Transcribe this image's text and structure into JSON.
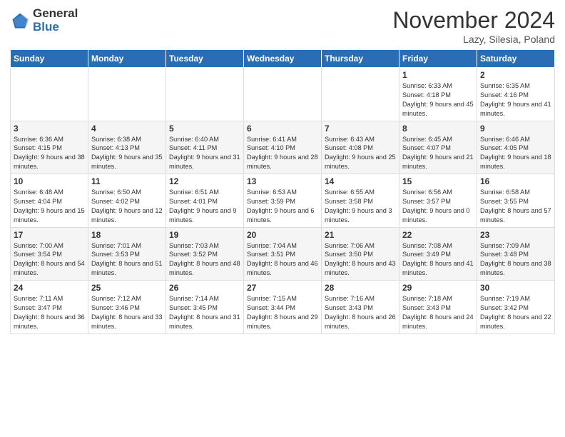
{
  "logo": {
    "general": "General",
    "blue": "Blue"
  },
  "header": {
    "month": "November 2024",
    "location": "Lazy, Silesia, Poland"
  },
  "weekdays": [
    "Sunday",
    "Monday",
    "Tuesday",
    "Wednesday",
    "Thursday",
    "Friday",
    "Saturday"
  ],
  "weeks": [
    [
      {
        "day": "",
        "info": ""
      },
      {
        "day": "",
        "info": ""
      },
      {
        "day": "",
        "info": ""
      },
      {
        "day": "",
        "info": ""
      },
      {
        "day": "",
        "info": ""
      },
      {
        "day": "1",
        "info": "Sunrise: 6:33 AM\nSunset: 4:18 PM\nDaylight: 9 hours and 45 minutes."
      },
      {
        "day": "2",
        "info": "Sunrise: 6:35 AM\nSunset: 4:16 PM\nDaylight: 9 hours and 41 minutes."
      }
    ],
    [
      {
        "day": "3",
        "info": "Sunrise: 6:36 AM\nSunset: 4:15 PM\nDaylight: 9 hours and 38 minutes."
      },
      {
        "day": "4",
        "info": "Sunrise: 6:38 AM\nSunset: 4:13 PM\nDaylight: 9 hours and 35 minutes."
      },
      {
        "day": "5",
        "info": "Sunrise: 6:40 AM\nSunset: 4:11 PM\nDaylight: 9 hours and 31 minutes."
      },
      {
        "day": "6",
        "info": "Sunrise: 6:41 AM\nSunset: 4:10 PM\nDaylight: 9 hours and 28 minutes."
      },
      {
        "day": "7",
        "info": "Sunrise: 6:43 AM\nSunset: 4:08 PM\nDaylight: 9 hours and 25 minutes."
      },
      {
        "day": "8",
        "info": "Sunrise: 6:45 AM\nSunset: 4:07 PM\nDaylight: 9 hours and 21 minutes."
      },
      {
        "day": "9",
        "info": "Sunrise: 6:46 AM\nSunset: 4:05 PM\nDaylight: 9 hours and 18 minutes."
      }
    ],
    [
      {
        "day": "10",
        "info": "Sunrise: 6:48 AM\nSunset: 4:04 PM\nDaylight: 9 hours and 15 minutes."
      },
      {
        "day": "11",
        "info": "Sunrise: 6:50 AM\nSunset: 4:02 PM\nDaylight: 9 hours and 12 minutes."
      },
      {
        "day": "12",
        "info": "Sunrise: 6:51 AM\nSunset: 4:01 PM\nDaylight: 9 hours and 9 minutes."
      },
      {
        "day": "13",
        "info": "Sunrise: 6:53 AM\nSunset: 3:59 PM\nDaylight: 9 hours and 6 minutes."
      },
      {
        "day": "14",
        "info": "Sunrise: 6:55 AM\nSunset: 3:58 PM\nDaylight: 9 hours and 3 minutes."
      },
      {
        "day": "15",
        "info": "Sunrise: 6:56 AM\nSunset: 3:57 PM\nDaylight: 9 hours and 0 minutes."
      },
      {
        "day": "16",
        "info": "Sunrise: 6:58 AM\nSunset: 3:55 PM\nDaylight: 8 hours and 57 minutes."
      }
    ],
    [
      {
        "day": "17",
        "info": "Sunrise: 7:00 AM\nSunset: 3:54 PM\nDaylight: 8 hours and 54 minutes."
      },
      {
        "day": "18",
        "info": "Sunrise: 7:01 AM\nSunset: 3:53 PM\nDaylight: 8 hours and 51 minutes."
      },
      {
        "day": "19",
        "info": "Sunrise: 7:03 AM\nSunset: 3:52 PM\nDaylight: 8 hours and 48 minutes."
      },
      {
        "day": "20",
        "info": "Sunrise: 7:04 AM\nSunset: 3:51 PM\nDaylight: 8 hours and 46 minutes."
      },
      {
        "day": "21",
        "info": "Sunrise: 7:06 AM\nSunset: 3:50 PM\nDaylight: 8 hours and 43 minutes."
      },
      {
        "day": "22",
        "info": "Sunrise: 7:08 AM\nSunset: 3:49 PM\nDaylight: 8 hours and 41 minutes."
      },
      {
        "day": "23",
        "info": "Sunrise: 7:09 AM\nSunset: 3:48 PM\nDaylight: 8 hours and 38 minutes."
      }
    ],
    [
      {
        "day": "24",
        "info": "Sunrise: 7:11 AM\nSunset: 3:47 PM\nDaylight: 8 hours and 36 minutes."
      },
      {
        "day": "25",
        "info": "Sunrise: 7:12 AM\nSunset: 3:46 PM\nDaylight: 8 hours and 33 minutes."
      },
      {
        "day": "26",
        "info": "Sunrise: 7:14 AM\nSunset: 3:45 PM\nDaylight: 8 hours and 31 minutes."
      },
      {
        "day": "27",
        "info": "Sunrise: 7:15 AM\nSunset: 3:44 PM\nDaylight: 8 hours and 29 minutes."
      },
      {
        "day": "28",
        "info": "Sunrise: 7:16 AM\nSunset: 3:43 PM\nDaylight: 8 hours and 26 minutes."
      },
      {
        "day": "29",
        "info": "Sunrise: 7:18 AM\nSunset: 3:43 PM\nDaylight: 8 hours and 24 minutes."
      },
      {
        "day": "30",
        "info": "Sunrise: 7:19 AM\nSunset: 3:42 PM\nDaylight: 8 hours and 22 minutes."
      }
    ]
  ]
}
